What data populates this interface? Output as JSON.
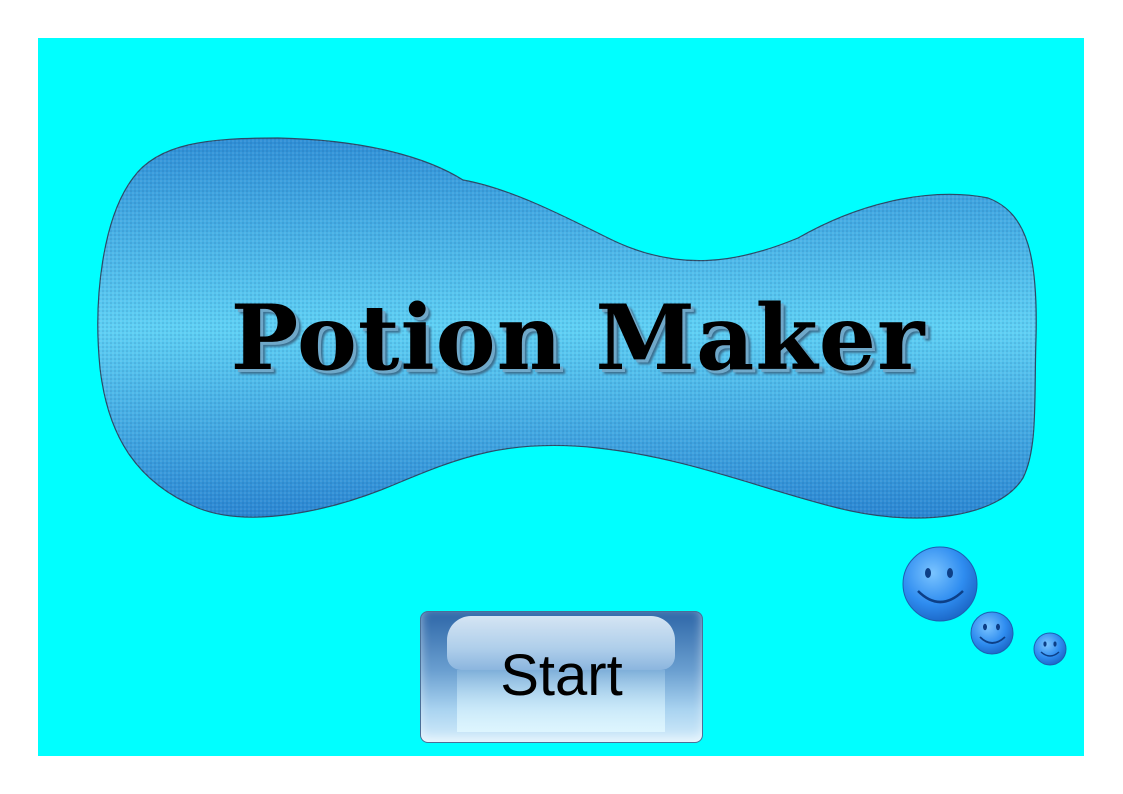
{
  "title": "Potion Maker",
  "start_button": {
    "label": "Start"
  },
  "colors": {
    "background": "#00ffff",
    "cloud_fill": "#3aaee8",
    "cloud_stroke": "#2b4a66",
    "button_top": "#2e67a8",
    "button_bottom": "#d3ecfb",
    "smiley": "#2f8df0"
  },
  "icons": [
    "thought-cloud",
    "smiley-face-icon"
  ]
}
